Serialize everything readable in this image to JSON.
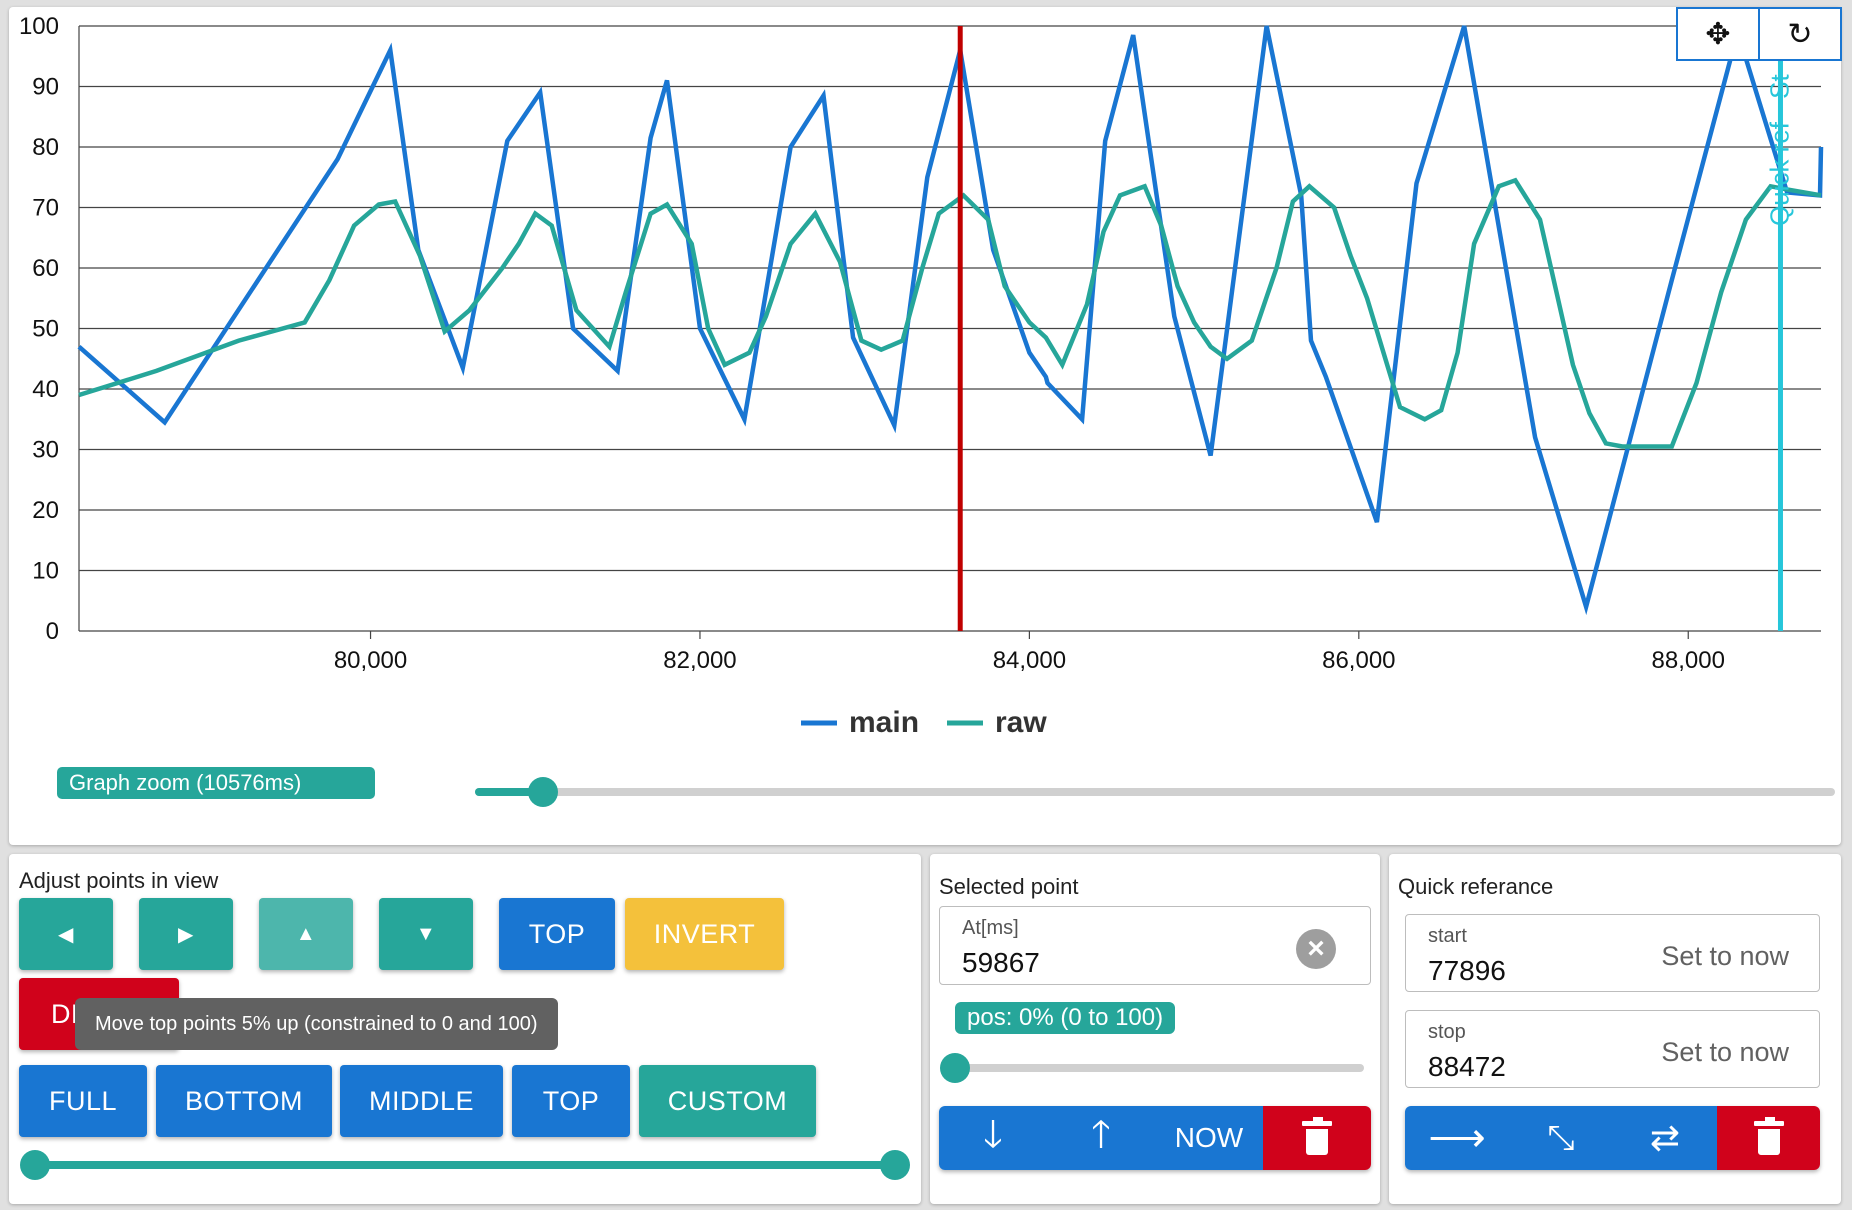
{
  "chart_data": {
    "type": "line",
    "xlim": [
      78230,
      88806
    ],
    "ylim": [
      0,
      100
    ],
    "yticks": [
      "0",
      "10",
      "20",
      "30",
      "40",
      "50",
      "60",
      "70",
      "80",
      "90",
      "100"
    ],
    "xticks": [
      {
        "value": 80000,
        "label": "80,000"
      },
      {
        "value": 82000,
        "label": "82,000"
      },
      {
        "value": 84000,
        "label": "84,000"
      },
      {
        "value": 86000,
        "label": "86,000"
      },
      {
        "value": 88000,
        "label": "88,000"
      }
    ],
    "series": [
      {
        "name": "main",
        "color": "#1976d2",
        "points": [
          [
            78230,
            47
          ],
          [
            78750,
            34.5
          ],
          [
            79800,
            78
          ],
          [
            80120,
            96
          ],
          [
            80290,
            63
          ],
          [
            80560,
            43.5
          ],
          [
            80830,
            81
          ],
          [
            81030,
            89
          ],
          [
            81230,
            50
          ],
          [
            81500,
            43
          ],
          [
            81700,
            81.5
          ],
          [
            81800,
            91
          ],
          [
            82000,
            50
          ],
          [
            82270,
            35
          ],
          [
            82550,
            80
          ],
          [
            82750,
            88.5
          ],
          [
            82930,
            48.5
          ],
          [
            83180,
            34
          ],
          [
            83380,
            75
          ],
          [
            83580,
            96
          ],
          [
            83780,
            63
          ],
          [
            84000,
            46
          ],
          [
            84100,
            42
          ],
          [
            84110,
            41
          ],
          [
            84320,
            35
          ],
          [
            84460,
            81
          ],
          [
            84630,
            98.5
          ],
          [
            84880,
            52
          ],
          [
            85100,
            29
          ],
          [
            85440,
            100
          ],
          [
            85650,
            72
          ],
          [
            85710,
            48
          ],
          [
            85800,
            42
          ],
          [
            86110,
            18
          ],
          [
            86350,
            74
          ],
          [
            86640,
            100
          ],
          [
            87070,
            32
          ],
          [
            87380,
            4
          ],
          [
            87900,
            58
          ],
          [
            88300,
            99
          ],
          [
            88600,
            72.5
          ],
          [
            88800,
            72
          ],
          [
            88806,
            80
          ]
        ]
      },
      {
        "name": "raw",
        "color": "#26a69a",
        "points": [
          [
            78230,
            39
          ],
          [
            78700,
            43
          ],
          [
            79200,
            48
          ],
          [
            79600,
            51
          ],
          [
            79750,
            58
          ],
          [
            79900,
            67
          ],
          [
            80050,
            70.5
          ],
          [
            80150,
            71
          ],
          [
            80300,
            62
          ],
          [
            80450,
            49.5
          ],
          [
            80600,
            53
          ],
          [
            80800,
            60
          ],
          [
            80900,
            64
          ],
          [
            81000,
            69
          ],
          [
            81100,
            67
          ],
          [
            81250,
            53
          ],
          [
            81450,
            47
          ],
          [
            81550,
            56
          ],
          [
            81700,
            69
          ],
          [
            81800,
            70.5
          ],
          [
            81950,
            64
          ],
          [
            82050,
            50
          ],
          [
            82150,
            44
          ],
          [
            82300,
            46
          ],
          [
            82400,
            52
          ],
          [
            82550,
            64
          ],
          [
            82700,
            69
          ],
          [
            82850,
            61
          ],
          [
            82980,
            48
          ],
          [
            83100,
            46.5
          ],
          [
            83230,
            48
          ],
          [
            83350,
            60
          ],
          [
            83450,
            69
          ],
          [
            83600,
            72
          ],
          [
            83750,
            68
          ],
          [
            83850,
            57
          ],
          [
            84000,
            51
          ],
          [
            84100,
            48.5
          ],
          [
            84200,
            44
          ],
          [
            84350,
            54
          ],
          [
            84450,
            66
          ],
          [
            84550,
            72
          ],
          [
            84700,
            73.5
          ],
          [
            84800,
            67
          ],
          [
            84900,
            57
          ],
          [
            85000,
            51
          ],
          [
            85100,
            47
          ],
          [
            85200,
            45
          ],
          [
            85350,
            48
          ],
          [
            85500,
            60
          ],
          [
            85600,
            71
          ],
          [
            85700,
            73.5
          ],
          [
            85850,
            70
          ],
          [
            85950,
            62
          ],
          [
            86050,
            55
          ],
          [
            86150,
            46
          ],
          [
            86250,
            37
          ],
          [
            86400,
            35
          ],
          [
            86500,
            36.5
          ],
          [
            86600,
            46
          ],
          [
            86700,
            64
          ],
          [
            86850,
            73.5
          ],
          [
            86950,
            74.5
          ],
          [
            87100,
            68
          ],
          [
            87200,
            56
          ],
          [
            87300,
            44
          ],
          [
            87400,
            36
          ],
          [
            87500,
            31
          ],
          [
            87600,
            30.5
          ],
          [
            87750,
            30.5
          ],
          [
            87900,
            30.5
          ],
          [
            88050,
            41
          ],
          [
            88200,
            56
          ],
          [
            88350,
            68
          ],
          [
            88500,
            73.5
          ],
          [
            88600,
            73
          ],
          [
            88806,
            72
          ]
        ]
      }
    ],
    "markers": [
      {
        "x": 83580,
        "color": "#c00000"
      },
      {
        "x": 88560,
        "color": "#26c6da",
        "label": "Quick ref - St"
      }
    ]
  },
  "legend": [
    {
      "label": "main",
      "color": "#1976d2"
    },
    {
      "label": "raw",
      "color": "#26a69a"
    }
  ],
  "toolbox": {
    "pan_icon": "move-arrows-icon",
    "reset_icon": "refresh-icon",
    "pan_glyph": "✥",
    "reset_glyph": "↻"
  },
  "zoom": {
    "label": "Graph zoom (10576ms)",
    "value_fraction": 0.05
  },
  "adjust": {
    "title": "Adjust points in view",
    "row1": [
      {
        "name": "move-left-button",
        "glyph": "◀"
      },
      {
        "name": "move-right-button",
        "glyph": "▶"
      },
      {
        "name": "move-up-button",
        "glyph": "▲"
      },
      {
        "name": "move-down-button",
        "glyph": "▼"
      }
    ],
    "top_label": "TOP",
    "invert_label": "INVERT",
    "delete_label": "DE",
    "tooltip": "Move top points 5% up (constrained to 0 and 100)",
    "range_buttons": [
      "FULL",
      "BOTTOM",
      "MIDDLE",
      "TOP",
      "CUSTOM"
    ],
    "range_slider": {
      "low": 0,
      "high": 100
    }
  },
  "selected": {
    "title": "Selected point",
    "field_label": "At[ms]",
    "field_value": "59867",
    "pos_label": "pos: 0% (0 to 100)",
    "pos_fraction": 0,
    "now_label": "NOW"
  },
  "qref": {
    "title": "Quick referance",
    "start_label": "start",
    "start_value": "77896",
    "stop_label": "stop",
    "stop_value": "88472",
    "set_now": "Set to now"
  },
  "colors": {
    "teal": "#26a69a",
    "blue": "#1976d2",
    "red": "#d0021b",
    "yellow": "#f4c13b",
    "cyan": "#26c6da"
  }
}
